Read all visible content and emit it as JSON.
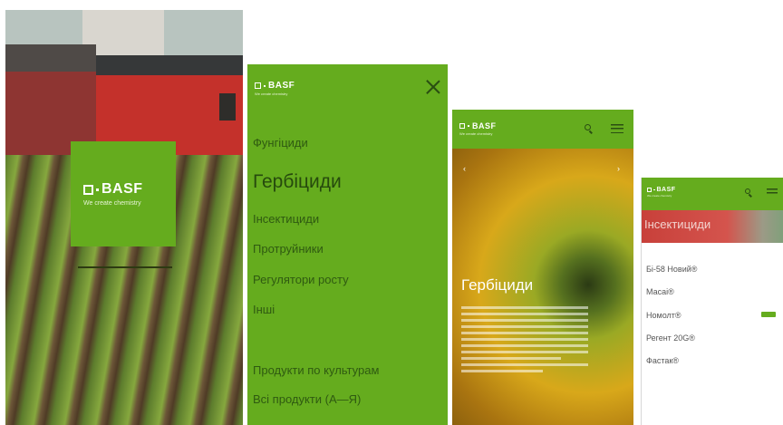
{
  "brand": {
    "name": "BASF",
    "tagline": "We create chemistry",
    "green": "#65ac1e"
  },
  "splash": {
    "logo_icon": "basf-logo-icon"
  },
  "menu": {
    "items": [
      "Фунгіциди",
      "Гербіциди",
      "Інсектициди",
      "Протруйники",
      "Регулятори росту",
      "Інші"
    ],
    "links": [
      "Продукти по культурам",
      "Всі продукти (А—Я)"
    ],
    "close_icon": "close-icon"
  },
  "herbicides": {
    "title": "Гербіциди",
    "search_icon": "search-icon",
    "menu_icon": "hamburger-icon"
  },
  "insecticides": {
    "title": "Інсектициди",
    "products": [
      "Бі-58 Новий®",
      "Масаі®",
      "Номолт®",
      "Регент 20G®",
      "Фастак®"
    ]
  }
}
